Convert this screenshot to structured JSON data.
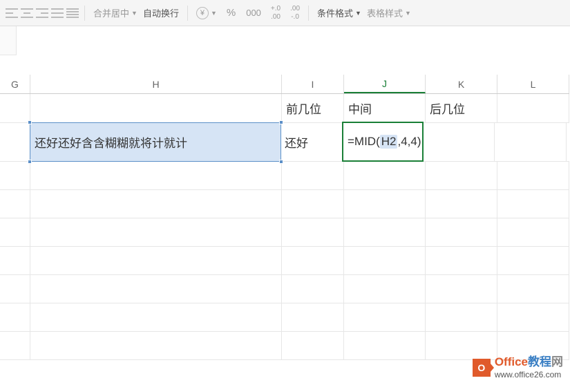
{
  "toolbar": {
    "merge_center": "合并居中",
    "wrap_text": "自动换行",
    "currency_symbol": "¥",
    "percent": "%",
    "thousands": "000",
    "dec_inc_top": "+.0",
    "dec_inc_bot": ".00",
    "dec_dec_top": ".00",
    "dec_dec_bot": "-.0",
    "cond_format": "条件格式",
    "table_style": "表格样式"
  },
  "columns": {
    "G": "G",
    "H": "H",
    "I": "I",
    "J": "J",
    "K": "K",
    "L": "L"
  },
  "cells": {
    "I1": "前几位",
    "J1": "中间",
    "K1": "后几位",
    "H2": "还好还好含含糊糊就将计就计",
    "I2": "还好",
    "J2_formula_pre": "=MID(",
    "J2_formula_ref": "H2",
    "J2_formula_post": ",4,4)"
  },
  "watermark": {
    "icon_letter": "O",
    "title_1": "Office",
    "title_2": "教程",
    "title_3": "网",
    "url": "www.office26.com"
  }
}
